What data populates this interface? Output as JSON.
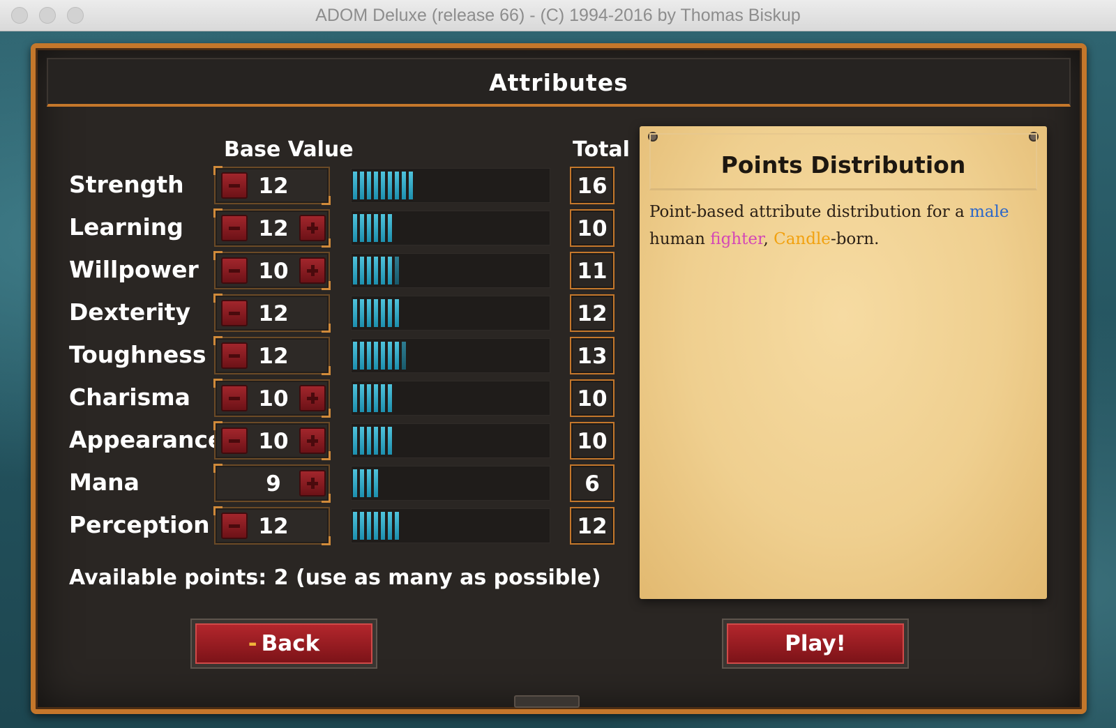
{
  "window": {
    "title": "ADOM Deluxe (release 66) - (C) 1994-2016 by Thomas Biskup"
  },
  "dialog": {
    "title": "Attributes"
  },
  "columns": {
    "base": "Base Value",
    "total": "Total"
  },
  "attributes": [
    {
      "name": "Strength",
      "base": "12",
      "total": "16",
      "has_minus": true,
      "has_plus": false,
      "bar_full": 9,
      "bar_faded": 0
    },
    {
      "name": "Learning",
      "base": "12",
      "total": "10",
      "has_minus": true,
      "has_plus": true,
      "bar_full": 6,
      "bar_faded": 0
    },
    {
      "name": "Willpower",
      "base": "10",
      "total": "11",
      "has_minus": true,
      "has_plus": true,
      "bar_full": 6,
      "bar_faded": 1
    },
    {
      "name": "Dexterity",
      "base": "12",
      "total": "12",
      "has_minus": true,
      "has_plus": false,
      "bar_full": 7,
      "bar_faded": 0
    },
    {
      "name": "Toughness",
      "base": "12",
      "total": "13",
      "has_minus": true,
      "has_plus": false,
      "bar_full": 7,
      "bar_faded": 1
    },
    {
      "name": "Charisma",
      "base": "10",
      "total": "10",
      "has_minus": true,
      "has_plus": true,
      "bar_full": 6,
      "bar_faded": 0
    },
    {
      "name": "Appearance",
      "base": "10",
      "total": "10",
      "has_minus": true,
      "has_plus": true,
      "bar_full": 6,
      "bar_faded": 0
    },
    {
      "name": "Mana",
      "base": "9",
      "total": "6",
      "has_minus": false,
      "has_plus": true,
      "bar_full": 4,
      "bar_faded": 0
    },
    {
      "name": "Perception",
      "base": "12",
      "total": "12",
      "has_minus": true,
      "has_plus": false,
      "bar_full": 7,
      "bar_faded": 0
    }
  ],
  "available_points": "Available points: 2 (use as many as possible)",
  "buttons": {
    "back_dash": "-",
    "back": "Back",
    "play": "Play!"
  },
  "panel": {
    "title": "Points Distribution",
    "text_1": "Point-based attribute distribution for a ",
    "male": "male",
    "text_2": " human ",
    "fighter": "fighter",
    "text_3": ", ",
    "candle": "Candle",
    "text_4": "-born."
  },
  "colors": {
    "frame": "#c4772b",
    "bar": "#3fb4d2",
    "button": "#a2262c",
    "male": "#2c67c9",
    "fighter": "#d447b6",
    "candle": "#f2a10f"
  }
}
